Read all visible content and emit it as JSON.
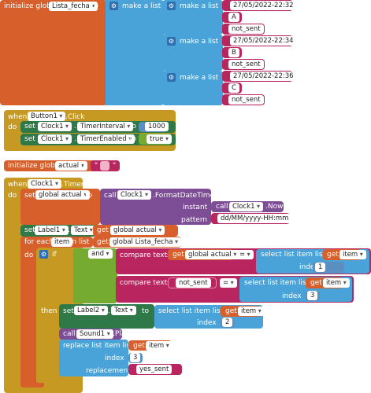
{
  "colors": {
    "variables": "#d65f2c",
    "lists": "#4aa3d8",
    "text": "#b8255f",
    "control_events": "#c69a22",
    "component_setters": "#2f7848",
    "logic": "#75ab31",
    "component_methods": "#7d4d95",
    "math": "#5a8fc2"
  },
  "icons": {
    "mutator": "gear-icon",
    "dropdown": "chevron-down-icon"
  },
  "init_lista": {
    "label": "initialize global",
    "name": "Lista_fecha",
    "to": "to",
    "make_list": "make a list",
    "sublists": [
      {
        "make_list": "make a list",
        "date": "27/05/2022-22:32",
        "letter": "A",
        "status": "not_sent"
      },
      {
        "make_list": "make a list",
        "date": "27/05/2022-22:34",
        "letter": "B",
        "status": "not_sent"
      },
      {
        "make_list": "make a list",
        "date": "27/05/2022-22:36",
        "letter": "C",
        "status": "not_sent"
      }
    ]
  },
  "button_click": {
    "when": "when",
    "component": "Button1",
    "event": ".Click",
    "do": "do",
    "rows": [
      {
        "set": "set",
        "component": "Clock1",
        "dot": ".",
        "property": "TimerInterval",
        "to": "to",
        "value": "1000"
      },
      {
        "set": "set",
        "component": "Clock1",
        "dot": ".",
        "property": "TimerEnabled",
        "to": "to",
        "value": "true"
      }
    ]
  },
  "init_actual": {
    "label": "initialize global",
    "name": "actual",
    "to": "to",
    "value": ""
  },
  "timer": {
    "when": "when",
    "component": "Clock1",
    "event": ".Timer",
    "do": "do",
    "set_global": {
      "set": "set",
      "var": "global actual",
      "to": "to"
    },
    "format_call": {
      "call": "call",
      "component": "Clock1",
      "method": ".FormatDateTime",
      "instant_label": "instant",
      "pattern_label": "pattern",
      "pattern": "dd/MM/yyyy-HH:mm"
    },
    "now_call": {
      "call": "call",
      "component": "Clock1",
      "method": ".Now"
    },
    "set_label1": {
      "set": "set",
      "component": "Label1",
      "dot": ".",
      "property": "Text",
      "to": "to",
      "get": "get",
      "var": "global actual"
    },
    "for_each": {
      "label": "for each",
      "item": "item",
      "in_list": "in list",
      "get": "get",
      "var": "global Lista_fecha"
    },
    "if": "if",
    "and": "and",
    "compare1": {
      "label": "compare texts",
      "get": "get",
      "var": "global actual",
      "op": "=",
      "select": "select list item  list",
      "get_item": "get",
      "item": "item",
      "index_label": "index",
      "index": "1"
    },
    "compare2": {
      "label": "compare texts",
      "text": "not_sent",
      "op": "=",
      "select": "select list item  list",
      "get_item": "get",
      "item": "item",
      "index_label": "index",
      "index": "3"
    },
    "then": "then",
    "set_label2": {
      "set": "set",
      "component": "Label2",
      "dot": ".",
      "property": "Text",
      "to": "to",
      "select": "select list item  list",
      "get": "get",
      "item": "item",
      "index_label": "index",
      "index": "2"
    },
    "play": {
      "call": "call",
      "component": "Sound1",
      "method": ".Play"
    },
    "replace": {
      "label": "replace list item  list",
      "get": "get",
      "item": "item",
      "index_label": "index",
      "index": "3",
      "replacement_label": "replacement",
      "replacement": "yes_sent"
    }
  }
}
